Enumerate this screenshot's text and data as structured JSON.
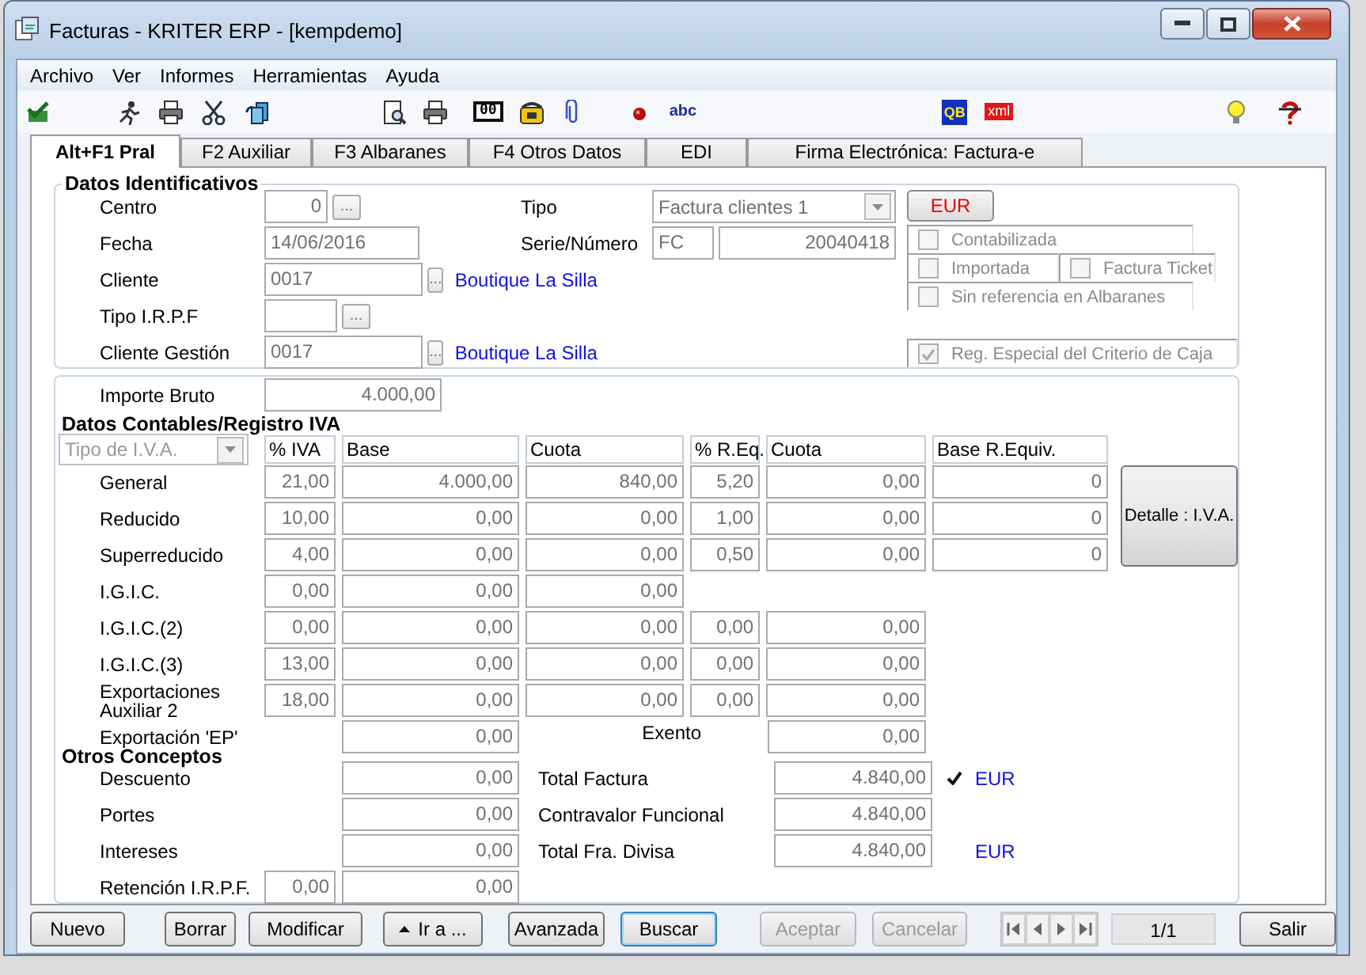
{
  "window": {
    "title": "Facturas - KRITER ERP - [kempdemo]"
  },
  "menu": [
    "Archivo",
    "Ver",
    "Informes",
    "Herramientas",
    "Ayuda"
  ],
  "toolbar": [
    {
      "kind": "check"
    },
    {
      "kind": "runner"
    },
    {
      "kind": "printer"
    },
    {
      "kind": "scissors"
    },
    {
      "kind": "documents"
    },
    {
      "kind": "preview"
    },
    {
      "kind": "printer"
    },
    {
      "kind": "badge",
      "text": "00"
    },
    {
      "kind": "phone"
    },
    {
      "kind": "clip"
    },
    {
      "kind": "ball"
    },
    {
      "kind": "spell",
      "text": "abc"
    },
    {
      "kind": "tile",
      "text": "QB"
    },
    {
      "kind": "tag",
      "text": "xml"
    },
    {
      "kind": "bulb"
    },
    {
      "kind": "help"
    }
  ],
  "tabs": [
    {
      "label": "Alt+F1 Pral",
      "selected": true
    },
    {
      "label": "F2 Auxiliar",
      "selected": false
    },
    {
      "label": "F3 Albaranes",
      "selected": false
    },
    {
      "label": "F4 Otros Datos",
      "selected": false
    },
    {
      "label": "EDI",
      "selected": false
    },
    {
      "label": "Firma Electrónica: Factura-e",
      "selected": false
    }
  ],
  "identification": {
    "title": "Datos Identificativos",
    "fields": [
      {
        "label": "Centro",
        "value": "0",
        "lookup_button": "..."
      },
      {
        "label": "Fecha",
        "value": "14/06/2016"
      },
      {
        "label": "Cliente",
        "value": "0017",
        "lookup_button": "...",
        "link": "Boutique La Silla"
      },
      {
        "label": "Tipo I.R.P.F",
        "lookup_button": "..."
      },
      {
        "label": "Cliente Gestión",
        "value": "0017",
        "lookup_button": "...",
        "link": "Boutique La Silla"
      }
    ],
    "tipo": {
      "label": "Tipo",
      "value": "Factura clientes 1"
    },
    "serie": {
      "label": "Serie/Número",
      "series": "FC",
      "number": "20040418"
    },
    "currency_button": "EUR",
    "flag_rows": [
      [
        {
          "label": "Contabilizada",
          "checked": false,
          "disabled": true
        }
      ],
      [
        {
          "label": "Importada",
          "checked": false,
          "disabled": true
        },
        {
          "label": "Factura Ticket",
          "checked": false,
          "disabled": true
        }
      ],
      [
        {
          "label": "Sin referencia en Albaranes",
          "checked": false,
          "disabled": true
        }
      ],
      [
        {
          "label": "Reg. Especial del Criterio de Caja",
          "checked": true,
          "disabled": true
        }
      ]
    ]
  },
  "importe_bruto": {
    "label": "Importe Bruto",
    "value": "4.000,00"
  },
  "vat": {
    "title": "Datos Contables/Registro IVA",
    "type_select": "Tipo de I.V.A.",
    "columns": [
      "% IVA",
      "Base",
      "Cuota",
      "% R.Eq.",
      "Cuota",
      "Base R.Equiv."
    ],
    "rows": [
      {
        "label": "General",
        "cells": [
          "21,00",
          "4.000,00",
          "840,00",
          "5,20",
          "0,00",
          "0"
        ]
      },
      {
        "label": "Reducido",
        "cells": [
          "10,00",
          "0,00",
          "0,00",
          "1,00",
          "0,00",
          "0"
        ]
      },
      {
        "label": "Superreducido",
        "cells": [
          "4,00",
          "0,00",
          "0,00",
          "0,50",
          "0,00",
          "0"
        ]
      },
      {
        "label": "I.G.I.C.",
        "cells": [
          "0,00",
          "0,00",
          "0,00"
        ]
      },
      {
        "label": "I.G.I.C.(2)",
        "cells": [
          "0,00",
          "0,00",
          "0,00",
          "0,00",
          "0,00"
        ]
      },
      {
        "label": "I.G.I.C.(3)",
        "cells": [
          "13,00",
          "0,00",
          "0,00",
          "0,00",
          "0,00"
        ]
      },
      {
        "label": "Exportaciones Auxiliar 2",
        "cells": [
          "18,00",
          "0,00",
          "0,00",
          "0,00",
          "0,00"
        ]
      }
    ],
    "export_row": {
      "label": "Exportación 'EP'",
      "base": "0,00",
      "exempt_label": "Exento",
      "exempt_value": "0,00"
    },
    "detail_button": "Detalle : I.V.A."
  },
  "other": {
    "title": "Otros Conceptos",
    "rows": [
      {
        "label": "Descuento",
        "value": "0,00"
      },
      {
        "label": "Portes",
        "value": "0,00"
      },
      {
        "label": "Intereses",
        "value": "0,00"
      },
      {
        "label": "Retención I.R.P.F.",
        "percent": "0,00",
        "value": "0,00"
      }
    ],
    "totals": [
      {
        "label": "Total Factura",
        "value": "4.840,00",
        "checked": true,
        "currency": "EUR"
      },
      {
        "label": "Contravalor Funcional",
        "value": "4.840,00",
        "checked": false
      },
      {
        "label": "Total Fra. Divisa",
        "value": "4.840,00",
        "checked": false,
        "currency": "EUR"
      }
    ]
  },
  "footer": {
    "buttons": [
      {
        "label": "Nuevo",
        "kind": "plain",
        "disabled": false,
        "focused": false
      },
      {
        "label": "Borrar",
        "kind": "plain",
        "disabled": false,
        "focused": false
      },
      {
        "label": "Modificar",
        "kind": "plain",
        "disabled": false,
        "focused": false
      },
      {
        "label": "Ir a ...",
        "kind": "menu",
        "disabled": false,
        "focused": false
      },
      {
        "label": "Avanzada",
        "kind": "plain",
        "disabled": false,
        "focused": false
      },
      {
        "label": "Buscar",
        "kind": "plain",
        "disabled": false,
        "focused": true
      },
      {
        "label": "Aceptar",
        "kind": "plain",
        "disabled": true,
        "focused": false
      },
      {
        "label": "Cancelar",
        "kind": "plain",
        "disabled": true,
        "focused": false
      }
    ],
    "record": "1/1",
    "exit_button": "Salir"
  }
}
